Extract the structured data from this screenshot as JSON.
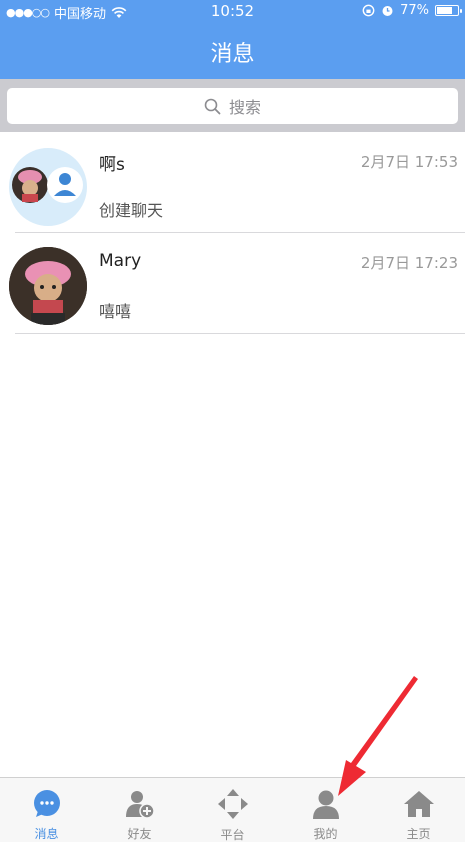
{
  "status_bar": {
    "carrier": "中国移动",
    "time": "10:52",
    "battery": "77%"
  },
  "header": {
    "title": "消息"
  },
  "search": {
    "placeholder": "搜索"
  },
  "conversations": [
    {
      "name": "啊s",
      "time": "2月7日 17:53",
      "message": "创建聊天"
    },
    {
      "name": "Mary",
      "time": "2月7日 17:23",
      "message": "嘻嘻"
    }
  ],
  "tabs": [
    {
      "label": "消息",
      "icon": "chat-bubble-icon",
      "active": true
    },
    {
      "label": "好友",
      "icon": "add-friend-icon",
      "active": false
    },
    {
      "label": "平台",
      "icon": "platform-arrows-icon",
      "active": false
    },
    {
      "label": "我的",
      "icon": "person-icon",
      "active": false
    },
    {
      "label": "主页",
      "icon": "home-icon",
      "active": false
    }
  ],
  "colors": {
    "header": "#5b9ef0",
    "tab_active": "#4a90e2",
    "tab_inactive": "#8a8a8a",
    "annotation_arrow": "#ee2a33"
  }
}
